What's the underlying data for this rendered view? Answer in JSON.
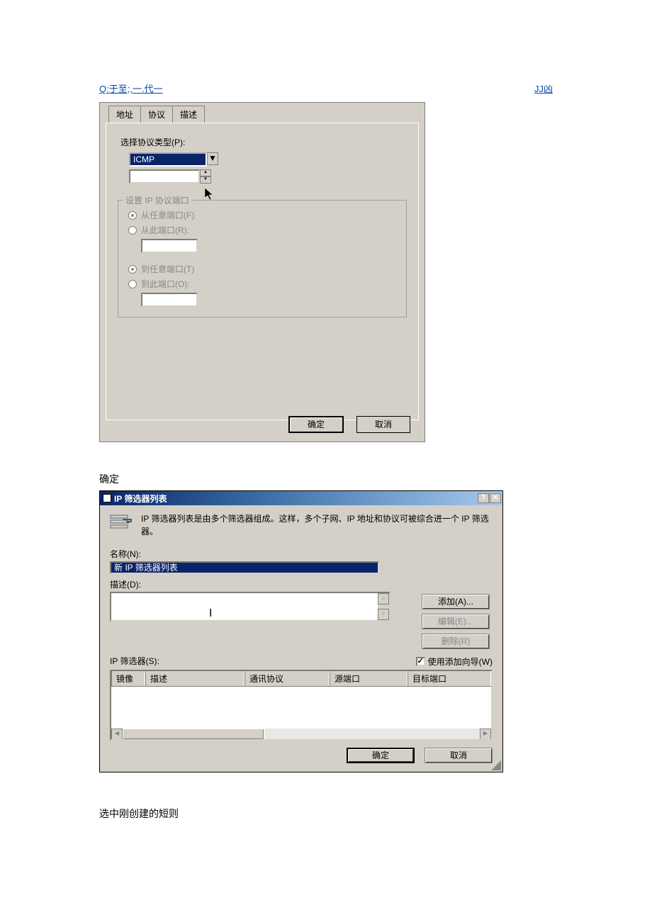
{
  "header": {
    "left": "Q:于至;,一.代一",
    "right": "JJ凶"
  },
  "dialog1": {
    "tabs": [
      "地址",
      "协议",
      "描述"
    ],
    "select_protocol_label": "选择协议类型(P):",
    "protocol_value": "ICMP",
    "port_section_legend": "设置 IP 协议端口",
    "from_any_port": "从任意端口(F)",
    "from_this_port": "从此端口(R):",
    "to_any_port": "到任意端口(T)",
    "to_this_port": "到此端口(O):",
    "ok": "确定",
    "cancel": "取消"
  },
  "caption1": "确定",
  "dialog2": {
    "title": "IP 筛选器列表",
    "info": "IP 筛选器列表是由多个筛选器组成。这样，多个子网、IP 地址和协议可被综合进一个 IP 筛选器。",
    "name_label": "名称(N):",
    "name_value": "新 IP 筛选器列表",
    "desc_label": "描述(D):",
    "add_btn": "添加(A)...",
    "edit_btn": "编辑(E)...",
    "delete_btn": "删除(R)",
    "filters_label": "IP 筛选器(S):",
    "use_wizard": "使用添加向导(W)",
    "cols": [
      "镜像",
      "描述",
      "通讯协议",
      "源端口",
      "目标端口"
    ],
    "ok": "确定",
    "cancel": "取消"
  },
  "caption2": "选中刚创建的短则"
}
